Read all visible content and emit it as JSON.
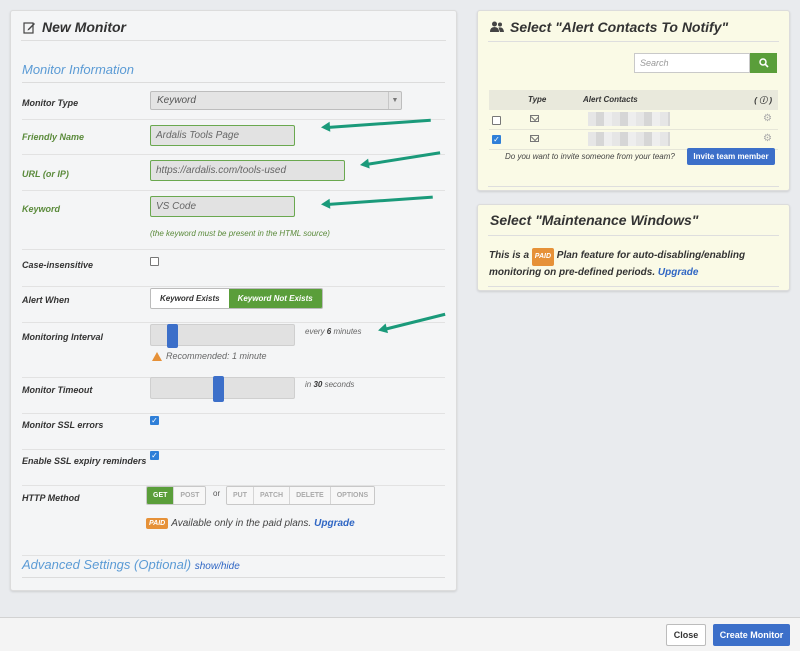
{
  "left_panel": {
    "title": "New Monitor",
    "section_title": "Monitor Information",
    "monitor_type": {
      "label": "Monitor Type",
      "value": "Keyword"
    },
    "friendly_name": {
      "label": "Friendly Name",
      "value": "Ardalis Tools Page"
    },
    "url": {
      "label": "URL (or IP)",
      "value": "https://ardalis.com/tools-used"
    },
    "keyword": {
      "label": "Keyword",
      "value": "VS Code",
      "hint": "(the keyword must be present in the HTML source)"
    },
    "case_insensitive": {
      "label": "Case-insensitive",
      "checked": false
    },
    "alert_when": {
      "label": "Alert When",
      "options": [
        "Keyword Exists",
        "Keyword Not Exists"
      ],
      "selected": "Keyword Not Exists"
    },
    "monitoring_interval": {
      "label": "Monitoring Interval",
      "prefix": "every",
      "value": "6",
      "suffix": "minutes",
      "level": 0.12,
      "recommended": "Recommended: 1 minute"
    },
    "monitor_timeout": {
      "label": "Monitor Timeout",
      "prefix": "in",
      "value": "30",
      "suffix": "seconds",
      "level": 0.47
    },
    "ssl_errors": {
      "label": "Monitor SSL errors",
      "checked": true
    },
    "ssl_expiry": {
      "label": "Enable SSL expiry reminders",
      "checked": true
    },
    "http_method": {
      "label": "HTTP Method",
      "group1": [
        "GET",
        "POST"
      ],
      "or": "or",
      "group2": [
        "PUT",
        "PATCH",
        "DELETE",
        "OPTIONS"
      ],
      "selected": "GET",
      "paid_badge": "PAID",
      "paid_note": "Available only in the paid plans.",
      "upgrade": "Upgrade"
    },
    "advanced": {
      "title": "Advanced Settings (Optional)",
      "toggle": "show/hide"
    }
  },
  "contacts_panel": {
    "title": "Select \"Alert Contacts To Notify\"",
    "search_placeholder": "Search",
    "columns": {
      "type": "Type",
      "contacts": "Alert Contacts",
      "info": "( ⓘ )"
    },
    "rows": [
      {
        "checked": false
      },
      {
        "checked": true
      }
    ],
    "invite_text": "Do you want to invite someone from your team?",
    "invite_button": "Invite team member"
  },
  "maint_panel": {
    "title": "Select \"Maintenance Windows\"",
    "pre": "This is a",
    "badge": "PAID",
    "post": "Plan feature for auto-disabling/enabling monitoring on pre-defined periods.",
    "upgrade": "Upgrade"
  },
  "footer": {
    "close": "Close",
    "create": "Create Monitor"
  },
  "colors": {
    "accent_green": "#5a9e3a",
    "accent_blue": "#3c6fc9",
    "arrow": "#1a9a7a",
    "paid": "#e69138"
  }
}
